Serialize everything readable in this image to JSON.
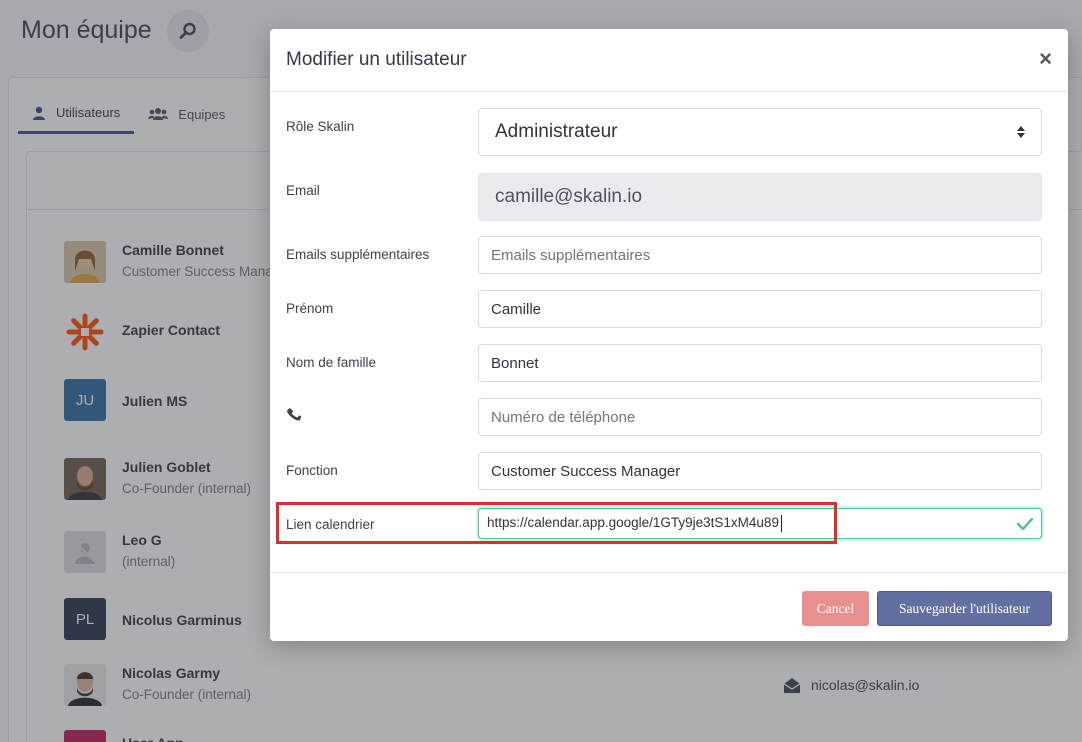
{
  "page": {
    "title": "Mon équipe",
    "tabs": [
      {
        "label": "Utilisateurs",
        "active": true
      },
      {
        "label": "Equipes",
        "active": false
      }
    ],
    "users": [
      {
        "name": "Camille Bonnet",
        "subtitle": "Customer Success Mana",
        "avatar": "photo"
      },
      {
        "name": "Zapier Contact",
        "subtitle": "",
        "avatar": "zapier-logo"
      },
      {
        "name": "Julien MS",
        "subtitle": "",
        "avatar_initials": "JU",
        "avatar_color": "#2e6aa0"
      },
      {
        "name": "Julien Goblet",
        "subtitle": "Co-Founder (internal)",
        "avatar": "photo"
      },
      {
        "name": "Leo G",
        "subtitle": "(internal)",
        "avatar": "placeholder"
      },
      {
        "name": "Nicolus Garminus",
        "subtitle": "",
        "avatar_initials": "PL",
        "avatar_color": "#26324a"
      },
      {
        "name": "Nicolas Garmy",
        "subtitle": "Co-Founder (internal)",
        "avatar": "photo"
      },
      {
        "name": "User App",
        "subtitle": "",
        "avatar": "photo"
      }
    ],
    "visible_email": "nicolas@skalin.io"
  },
  "modal": {
    "title": "Modifier un utilisateur",
    "close_label": "×",
    "fields": {
      "role": {
        "label": "Rôle Skalin",
        "value": "Administrateur"
      },
      "email": {
        "label": "Email",
        "value": "camille@skalin.io"
      },
      "extra_emails": {
        "label": "Emails supplémentaires",
        "placeholder": "Emails supplémentaires"
      },
      "first_name": {
        "label": "Prénom",
        "value": "Camille"
      },
      "last_name": {
        "label": "Nom de famille",
        "value": "Bonnet"
      },
      "phone": {
        "placeholder": "Numéro de téléphone"
      },
      "function": {
        "label": "Fonction",
        "value": "Customer Success Manager"
      },
      "calendar": {
        "label": "Lien calendrier",
        "value": "https://calendar.app.google/1GTy9je3tS1xM4u89"
      }
    },
    "buttons": {
      "cancel": "Cancel",
      "save": "Sauvegarder l'utilisateur"
    }
  },
  "colors": {
    "primary": "#626fa0",
    "cancel": "#e8908f",
    "valid": "#56c29a",
    "highlight": "#e22b2b"
  }
}
